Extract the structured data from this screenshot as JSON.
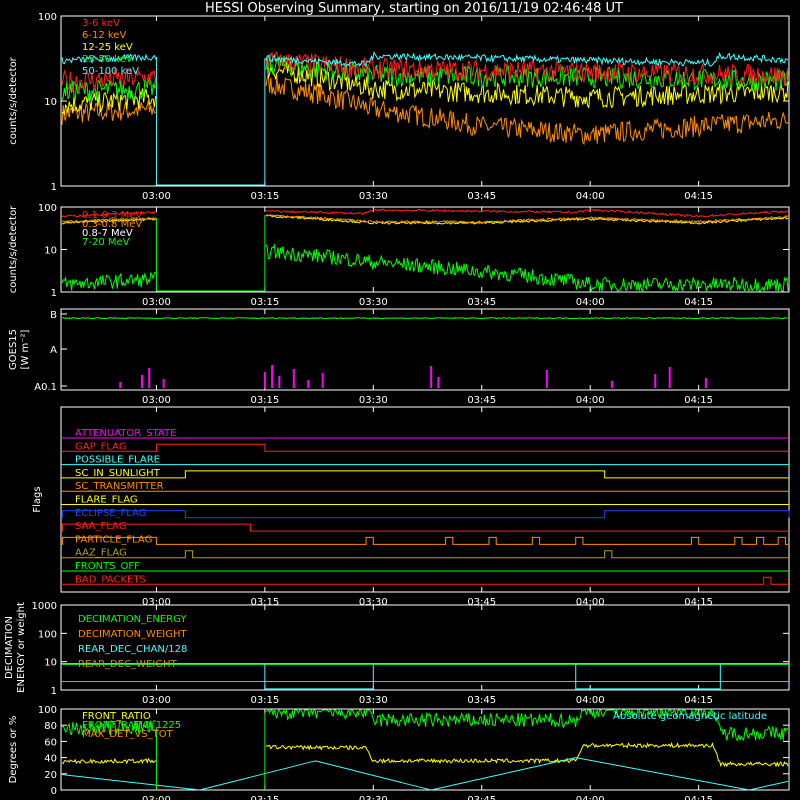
{
  "title": "HESSI Observing Summary, starting on 2016/11/19 02:46:48 UT",
  "time_axis": {
    "start": "02:46:48",
    "end": "04:28",
    "ticks": [
      "03:00",
      "03:15",
      "03:30",
      "03:45",
      "04:00",
      "04:15"
    ]
  },
  "colors": {
    "magenta": "#ff00ff",
    "red": "#ff2020",
    "orange": "#ff8c00",
    "yellow": "#ffff00",
    "green": "#00ff00",
    "cyan": "#40ffff",
    "blue": "#2040ff",
    "olive": "#b0a020",
    "white": "#ffffff"
  },
  "chart_data": [
    {
      "type": "line",
      "id": "panel1",
      "ylabel": "counts/s/detector",
      "yscale": "log",
      "ylim": [
        1,
        100
      ],
      "yticks": [
        "100",
        "10",
        "1"
      ],
      "legend": [
        "3-6 keV",
        "6-12 keV",
        "12-25 keV",
        "25-50 keV",
        "50-100 keV"
      ],
      "legend_colors": [
        "#ff2020",
        "#ff8c00",
        "#ffff00",
        "#00ff00",
        "#40ffff"
      ],
      "data_gaps": [
        [
          "03:00",
          "03:15"
        ]
      ],
      "series": [
        {
          "name": "50-100 keV",
          "x": [
            "02:47",
            "03:00",
            "03:15",
            "03:29",
            "03:30",
            "04:00",
            "04:17",
            "04:18",
            "04:28"
          ],
          "values": [
            30,
            33,
            32,
            27,
            34,
            30,
            28,
            34,
            30
          ]
        },
        {
          "name": "3-6 keV",
          "x": [
            "02:47",
            "03:00",
            "03:15",
            "03:30",
            "04:00",
            "04:28"
          ],
          "values": [
            17,
            19,
            30,
            24,
            22,
            20
          ]
        },
        {
          "name": "25-50 keV",
          "x": [
            "02:47",
            "03:00",
            "03:15",
            "03:30",
            "04:00",
            "04:28"
          ],
          "values": [
            13,
            14,
            27,
            20,
            19,
            17
          ]
        },
        {
          "name": "12-25 keV",
          "x": [
            "02:47",
            "03:00",
            "03:15",
            "03:30",
            "04:00",
            "04:28"
          ],
          "values": [
            9,
            11,
            24,
            14,
            11,
            13
          ]
        },
        {
          "name": "6-12 keV",
          "x": [
            "02:47",
            "03:00",
            "03:15",
            "03:30",
            "03:45",
            "04:00",
            "04:28"
          ],
          "values": [
            7,
            8,
            16,
            8,
            5,
            4,
            6
          ]
        }
      ]
    },
    {
      "type": "line",
      "id": "panel2",
      "ylabel": "counts/s/detector",
      "yscale": "log",
      "ylim": [
        1,
        100
      ],
      "yticks": [
        "100",
        "10",
        "1"
      ],
      "legend": [
        "0.1-0.3 MeV",
        "0.3-0.8 MeV",
        "0.8-7 MeV",
        "7-20 MeV"
      ],
      "legend_colors": [
        "#ff2020",
        "#ff8c00",
        "#ffffff",
        "#00ff00"
      ],
      "series": [
        {
          "name": "0.1-0.3 MeV",
          "x": [
            "02:47",
            "03:00",
            "03:15",
            "03:29",
            "03:30",
            "03:58",
            "04:00",
            "04:15",
            "04:28"
          ],
          "values": [
            60,
            75,
            80,
            70,
            85,
            75,
            85,
            60,
            80
          ]
        },
        {
          "name": "0.3-0.8 MeV",
          "x": [
            "02:47",
            "03:00",
            "03:15",
            "03:30",
            "03:45",
            "04:00",
            "04:15",
            "04:28"
          ],
          "values": [
            45,
            55,
            65,
            45,
            45,
            55,
            45,
            60
          ]
        },
        {
          "name": "0.8-7 MeV",
          "x": [
            "02:47",
            "03:00",
            "03:15",
            "03:30",
            "03:45",
            "04:00",
            "04:15",
            "04:28"
          ],
          "values": [
            42,
            52,
            62,
            42,
            42,
            52,
            42,
            56
          ]
        },
        {
          "name": "7-20 MeV",
          "x": [
            "02:47",
            "03:00",
            "03:15",
            "03:30",
            "03:45",
            "04:00",
            "04:28"
          ],
          "values": [
            1.5,
            2,
            9,
            5,
            3,
            1.5,
            1.5
          ]
        }
      ]
    },
    {
      "type": "line",
      "id": "panel3",
      "ylabel": "GOES15",
      "ylabel2": "[W m⁻²]",
      "ytick_labels": [
        "B",
        "A",
        "A0.1"
      ],
      "series": [
        {
          "name": "GOES",
          "x": [
            "02:47",
            "03:30",
            "04:00",
            "04:28"
          ],
          "values": [
            0.93,
            0.93,
            0.93,
            0.93
          ]
        }
      ],
      "spikes_x": [
        "02:55",
        "02:58",
        "02:59",
        "03:01",
        "03:15",
        "03:16",
        "03:17",
        "03:19",
        "03:21",
        "03:23",
        "03:38",
        "03:39",
        "03:54",
        "04:03",
        "04:09",
        "04:11",
        "04:16"
      ]
    },
    {
      "type": "table",
      "id": "panel4",
      "ylabel": "Flags",
      "flags": [
        {
          "name": "ATTENUATOR_STATE",
          "color": "#ff00ff",
          "on": []
        },
        {
          "name": "GAP_FLAG",
          "color": "#ff2020",
          "on": [
            [
              "03:00",
              "03:15"
            ]
          ]
        },
        {
          "name": "POSSIBLE_FLARE",
          "color": "#40ffff",
          "on": []
        },
        {
          "name": "SC_IN_SUNLIGHT",
          "color": "#ffff00",
          "on": [
            [
              "03:04",
              "04:02"
            ]
          ]
        },
        {
          "name": "SC_TRANSMITTER",
          "color": "#ff8c00",
          "on": []
        },
        {
          "name": "FLARE_FLAG",
          "color": "#ffff00",
          "on": []
        },
        {
          "name": "ECLIPSE_FLAG",
          "color": "#2040ff",
          "on": [
            [
              "02:47",
              "03:04"
            ],
            [
              "04:02",
              "04:28"
            ]
          ]
        },
        {
          "name": "SAA_FLAG",
          "color": "#ff2020",
          "on": [
            [
              "02:47",
              "03:13"
            ]
          ]
        },
        {
          "name": "PARTICLE_FLAG",
          "color": "#ff8c00",
          "on": [
            [
              "02:47",
              "03:00"
            ],
            [
              "03:29",
              "03:30"
            ],
            [
              "03:40",
              "03:41"
            ],
            [
              "03:46",
              "03:47"
            ],
            [
              "03:52",
              "03:53"
            ],
            [
              "03:58",
              "03:59"
            ],
            [
              "04:14",
              "04:15"
            ],
            [
              "04:20",
              "04:21"
            ],
            [
              "04:23",
              "04:24"
            ],
            [
              "04:26",
              "04:27"
            ]
          ]
        },
        {
          "name": "AAZ_FLAG",
          "color": "#b0a020",
          "on": [
            [
              "03:04",
              "03:05"
            ],
            [
              "04:02",
              "04:03"
            ]
          ]
        },
        {
          "name": "FRONTS_OFF",
          "color": "#00ff00",
          "on": []
        },
        {
          "name": "BAD_PACKETS",
          "color": "#ff2020",
          "on": [
            [
              "04:24",
              "04:25"
            ]
          ]
        }
      ]
    },
    {
      "type": "line",
      "id": "panel5",
      "ylabel": "DECIMATION",
      "ylabel2": "ENERGY or weight",
      "yscale": "log",
      "ylim": [
        1,
        1000
      ],
      "yticks": [
        "1000",
        "100",
        "10",
        "1"
      ],
      "legend": [
        "DECIMATION_ENERGY",
        "DECIMATION_WEIGHT",
        "REAR_DEC_CHAN/128",
        "REAR_DEC_WEIGHT"
      ],
      "legend_colors": [
        "#00ff00",
        "#ff8c00",
        "#40ffff",
        "#b0a020"
      ],
      "series": [
        {
          "name": "DECIMATION_ENERGY",
          "x": [
            "02:47",
            "04:28"
          ],
          "values": [
            1,
            1
          ]
        },
        {
          "name": "DECIMATION_WEIGHT",
          "x": [
            "02:47",
            "04:28"
          ],
          "values": [
            2,
            2
          ]
        },
        {
          "name": "REAR_DEC_CHAN/128",
          "x": [
            "02:47",
            "03:15",
            "03:15",
            "03:30",
            "03:30",
            "03:58",
            "03:58",
            "04:18",
            "04:18",
            "04:28"
          ],
          "values": [
            8,
            8,
            8,
            8,
            8,
            8,
            8,
            8,
            8,
            8
          ]
        },
        {
          "name": "REAR_DEC_WEIGHT",
          "x": [
            "02:47",
            "04:28"
          ],
          "values": [
            8,
            8
          ]
        }
      ]
    },
    {
      "type": "line",
      "id": "panel6",
      "ylabel": "Degrees or %",
      "ylim": [
        0,
        100
      ],
      "yticks": [
        "100",
        "80",
        "60",
        "40",
        "20",
        "0"
      ],
      "legend": [
        "FRONT_RATIO",
        "FRONT_RATIO_1225",
        "MAX_DET_VS_TOT"
      ],
      "legend_colors": [
        "#ffff00",
        "#00ff00",
        "#ff8c00"
      ],
      "annotation": "Absolute geomagnetic latitude",
      "series": [
        {
          "name": "FRONT_RATIO",
          "x": [
            "02:47",
            "03:00",
            "03:15",
            "03:29",
            "03:30",
            "03:58",
            "03:59",
            "04:17",
            "04:18",
            "04:28"
          ],
          "values": [
            35,
            36,
            53,
            52,
            36,
            36,
            55,
            55,
            32,
            32
          ]
        },
        {
          "name": "FRONT_RATIO_1225",
          "x": [
            "02:47",
            "03:00",
            "03:15",
            "03:29",
            "03:30",
            "03:58",
            "03:59",
            "04:17",
            "04:18",
            "04:28"
          ],
          "values": [
            75,
            78,
            96,
            96,
            86,
            86,
            98,
            98,
            70,
            70
          ]
        },
        {
          "name": "MAX_DET_VS_TOT",
          "x": [
            "02:47",
            "04:28"
          ],
          "values": [
            28,
            28
          ]
        },
        {
          "name": "Absolute geomagnetic latitude",
          "x": [
            "02:47",
            "03:06",
            "03:22",
            "03:38",
            "03:58",
            "04:22",
            "04:28"
          ],
          "values": [
            19,
            0,
            36,
            0,
            40,
            0,
            12
          ]
        }
      ]
    }
  ]
}
